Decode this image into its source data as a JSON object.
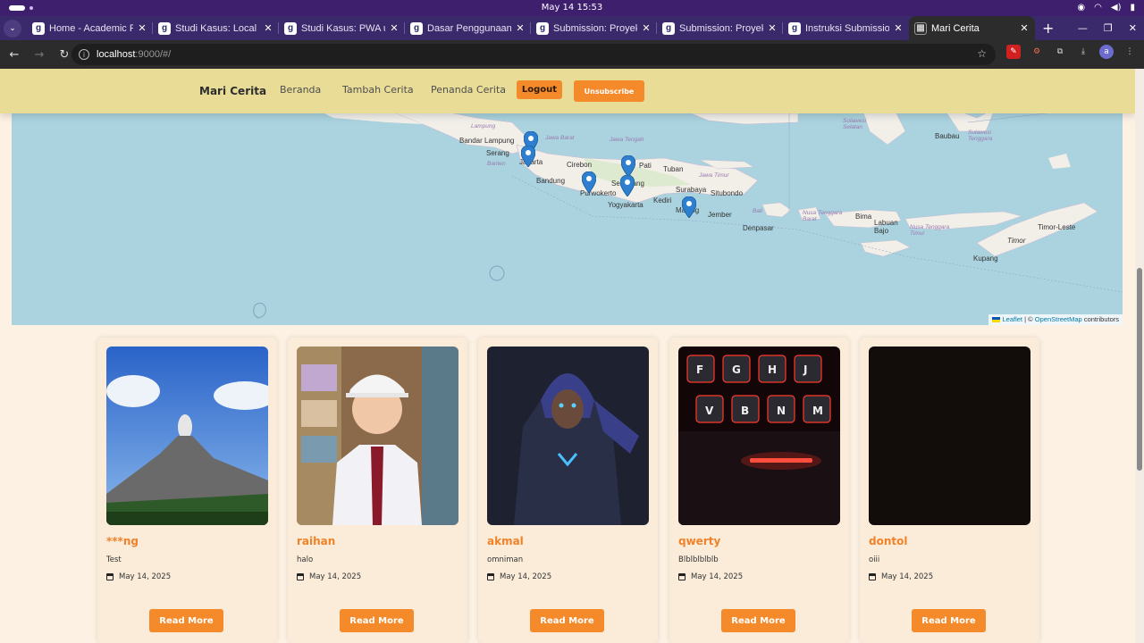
{
  "os": {
    "clock": "May 14  15:53"
  },
  "browser": {
    "tabs": [
      {
        "title": "Home - Academic Pro",
        "favicon": "dicoding-icon"
      },
      {
        "title": "Studi Kasus: Local Da",
        "favicon": "dicoding-icon"
      },
      {
        "title": "Studi Kasus: PWA un",
        "favicon": "dicoding-icon"
      },
      {
        "title": "Dasar Penggunaan C",
        "favicon": "dicoding-icon"
      },
      {
        "title": "Submission: Proyek |",
        "favicon": "dicoding-icon"
      },
      {
        "title": "Submission: Proyek |",
        "favicon": "dicoding-icon"
      },
      {
        "title": "Instruksi Submission",
        "favicon": "dicoding-icon"
      },
      {
        "title": "Mari Cerita",
        "favicon": "grid-icon",
        "active": true
      }
    ],
    "url_host": "localhost",
    "url_rest": ":9000/#/",
    "profile_initial": "a"
  },
  "app": {
    "brand": "Mari Cerita",
    "nav": {
      "home": "Beranda",
      "add_story": "Tambah Cerita",
      "bookmarks": "Penanda Cerita"
    },
    "logout_label": "Logout",
    "unsubscribe_label": "Unsubscribe",
    "accent_color": "#f58a2a",
    "header_color": "#e8dc96"
  },
  "map": {
    "labels": {
      "lampung_prov": "Lampung",
      "bandar_lampung": "Bandar Lampung",
      "serang": "Serang",
      "banten": "Banten",
      "jakarta": "Jakarta",
      "jawa_barat": "Jawa Barat",
      "jawa_tengah": "Jawa Tengah",
      "cirebon": "Cirebon",
      "bandung": "Bandung",
      "purwokerto": "Purwokerto",
      "pati": "Pati",
      "tuban": "Tuban",
      "semarang": "Semarang",
      "jawa_timur": "Jawa Timur",
      "surabaya": "Surabaya",
      "situbondo": "Situbondo",
      "kediri": "Kediri",
      "yogyakarta": "Yogyakarta",
      "malang": "Malang",
      "jember": "Jember",
      "bali": "Bali",
      "denpasar": "Denpasar",
      "ntb": "Nusa Tenggara Barat",
      "bima": "Bima",
      "labuan_bajo": "Labuan Bajo",
      "ntt": "Nusa Tenggara Timur",
      "timor": "Timor",
      "timor_leste": "Timor-Leste",
      "kupang": "Kupang",
      "sulsel": "Sulawesi Selatan",
      "sultra": "Sulawesi Tenggara",
      "baubau": "Baubau"
    },
    "attribution": {
      "leaflet": "Leaflet",
      "sep": "| ©",
      "osm": "OpenStreetMap",
      "contributors": "contributors"
    }
  },
  "stories": [
    {
      "name": "***ng",
      "description": "Test",
      "date": "May 14, 2025",
      "read_more": "Read More",
      "image": "volcano-photo"
    },
    {
      "name": "raihan",
      "description": "halo",
      "date": "May 14, 2025",
      "read_more": "Read More",
      "image": "child-school-uniform-photo"
    },
    {
      "name": "akmal",
      "description": "omniman",
      "date": "May 14, 2025",
      "read_more": "Read More",
      "image": "hooded-hero-art"
    },
    {
      "name": "qwerty",
      "description": "Blblblblblb",
      "date": "May 14, 2025",
      "read_more": "Read More",
      "image": "red-keyboard-photo"
    },
    {
      "name": "dontol",
      "description": "oiii",
      "date": "May 14, 2025",
      "read_more": "Read More",
      "image": "dark-photo"
    }
  ]
}
